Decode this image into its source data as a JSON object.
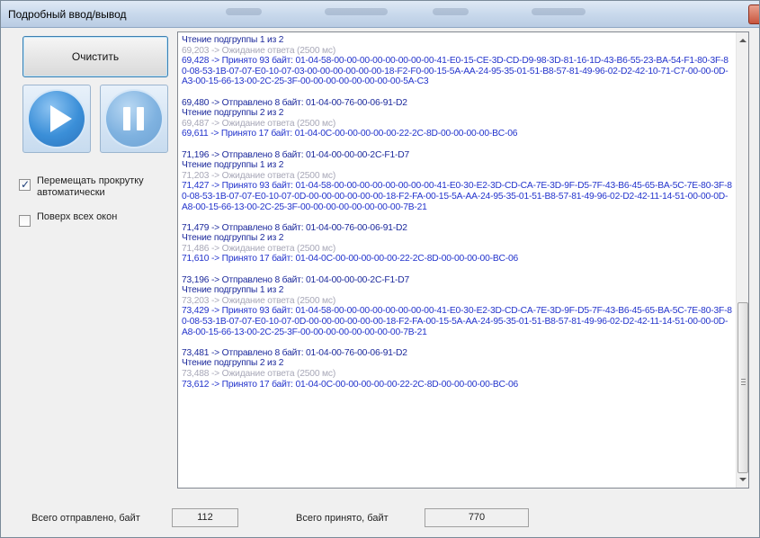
{
  "window": {
    "title": "Подробный ввод/вывод"
  },
  "controls": {
    "clear_label": "Очистить",
    "auto_scroll_label": "Перемещать прокрутку автоматически",
    "auto_scroll_checked": true,
    "on_top_label": "Поверх всех окон",
    "on_top_checked": false
  },
  "log": {
    "entries": [
      {
        "lines": [
          {
            "kind": "info",
            "text": "Чтение подгруппы 1 из 2"
          },
          {
            "kind": "wait",
            "text": "69,203 -> Ожидание ответа (2500 мс)"
          },
          {
            "kind": "recv",
            "text": "69,428 -> Принято 93 байт: 01-04-58-00-00-00-00-00-00-00-00-41-E0-15-CE-3D-CD-D9-98-3D-81-16-1D-43-B6-55-23-BA-54-F1-80-3F-80-08-53-1B-07-07-E0-10-07-03-00-00-00-00-00-00-18-F2-F0-00-15-5A-AA-24-95-35-01-51-B8-57-81-49-96-02-D2-42-10-71-C7-00-00-0D-A3-00-15-66-13-00-2C-25-3F-00-00-00-00-00-00-00-00-5A-C3"
          }
        ]
      },
      {
        "lines": [
          {
            "kind": "sent",
            "text": "69,480 -> Отправлено 8 байт: 01-04-00-76-00-06-91-D2"
          },
          {
            "kind": "info",
            "text": "Чтение подгруппы 2 из 2"
          },
          {
            "kind": "wait",
            "text": "69,487 -> Ожидание ответа (2500 мс)"
          },
          {
            "kind": "recv",
            "text": "69,611 -> Принято 17 байт: 01-04-0C-00-00-00-00-00-22-2C-8D-00-00-00-00-BC-06"
          }
        ]
      },
      {
        "lines": [
          {
            "kind": "sent",
            "text": "71,196 -> Отправлено 8 байт: 01-04-00-00-00-2C-F1-D7"
          },
          {
            "kind": "info",
            "text": "Чтение подгруппы 1 из 2"
          },
          {
            "kind": "wait",
            "text": "71,203 -> Ожидание ответа (2500 мс)"
          },
          {
            "kind": "recv",
            "text": "71,427 -> Принято 93 байт: 01-04-58-00-00-00-00-00-00-00-00-41-E0-30-E2-3D-CD-CA-7E-3D-9F-D5-7F-43-B6-45-65-BA-5C-7E-80-3F-80-08-53-1B-07-07-E0-10-07-0D-00-00-00-00-00-00-18-F2-FA-00-15-5A-AA-24-95-35-01-51-B8-57-81-49-96-02-D2-42-11-14-51-00-00-0D-A8-00-15-66-13-00-2C-25-3F-00-00-00-00-00-00-00-00-7B-21"
          }
        ]
      },
      {
        "lines": [
          {
            "kind": "sent",
            "text": "71,479 -> Отправлено 8 байт: 01-04-00-76-00-06-91-D2"
          },
          {
            "kind": "info",
            "text": "Чтение подгруппы 2 из 2"
          },
          {
            "kind": "wait",
            "text": "71,486 -> Ожидание ответа (2500 мс)"
          },
          {
            "kind": "recv",
            "text": "71,610 -> Принято 17 байт: 01-04-0C-00-00-00-00-00-22-2C-8D-00-00-00-00-BC-06"
          }
        ]
      },
      {
        "lines": [
          {
            "kind": "sent",
            "text": "73,196 -> Отправлено 8 байт: 01-04-00-00-00-2C-F1-D7"
          },
          {
            "kind": "info",
            "text": "Чтение подгруппы 1 из 2"
          },
          {
            "kind": "wait",
            "text": "73,203 -> Ожидание ответа (2500 мс)"
          },
          {
            "kind": "recv",
            "text": "73,429 -> Принято 93 байт: 01-04-58-00-00-00-00-00-00-00-00-41-E0-30-E2-3D-CD-CA-7E-3D-9F-D5-7F-43-B6-45-65-BA-5C-7E-80-3F-80-08-53-1B-07-07-E0-10-07-0D-00-00-00-00-00-00-18-F2-FA-00-15-5A-AA-24-95-35-01-51-B8-57-81-49-96-02-D2-42-11-14-51-00-00-0D-A8-00-15-66-13-00-2C-25-3F-00-00-00-00-00-00-00-00-7B-21"
          }
        ]
      },
      {
        "lines": [
          {
            "kind": "sent",
            "text": "73,481 -> Отправлено 8 байт: 01-04-00-76-00-06-91-D2"
          },
          {
            "kind": "info",
            "text": "Чтение подгруппы 2 из 2"
          },
          {
            "kind": "wait",
            "text": "73,488 -> Ожидание ответа (2500 мс)"
          },
          {
            "kind": "recv",
            "text": "73,612 -> Принято 17 байт: 01-04-0C-00-00-00-00-00-22-2C-8D-00-00-00-00-BC-06"
          }
        ]
      }
    ]
  },
  "footer": {
    "sent_label": "Всего отправлено, байт",
    "sent_value": "112",
    "recv_label": "Всего принято, байт",
    "recv_value": "770"
  },
  "colors": {
    "sent": "#1d2a9c",
    "received": "#2233cc",
    "waiting": "#a8a8b8",
    "button_blue": "#3b8fd8"
  }
}
